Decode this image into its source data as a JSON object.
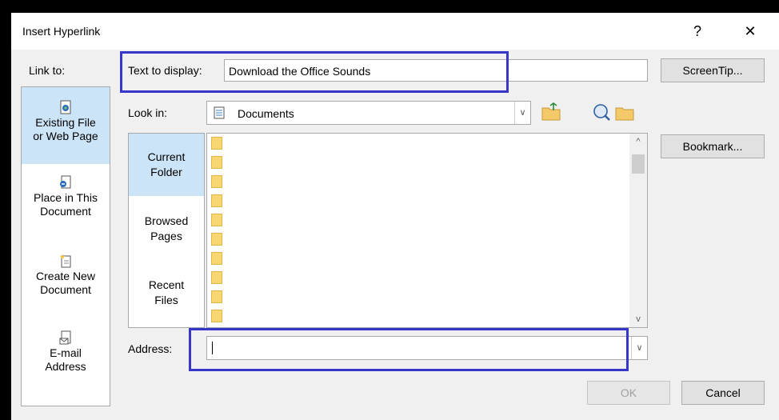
{
  "window": {
    "title": "Insert Hyperlink",
    "help_glyph": "?",
    "close_glyph": "✕"
  },
  "link_to": {
    "label": "Link to:",
    "items": [
      {
        "line1": "Existing File",
        "line2": "or Web Page",
        "icon": "existing-file-icon"
      },
      {
        "line1": "Place in This",
        "line2": "Document",
        "icon": "place-in-document-icon"
      },
      {
        "line1": "Create New",
        "line2": "Document",
        "icon": "create-new-document-icon"
      },
      {
        "line1": "E-mail",
        "line2": "Address",
        "icon": "email-address-icon"
      }
    ]
  },
  "text_to_display": {
    "label": "Text to display:",
    "value": "Download the Office Sounds"
  },
  "screentip_label": "ScreenTip...",
  "look_in": {
    "label": "Look in:",
    "value": "Documents"
  },
  "bookmark_label": "Bookmark...",
  "nav": {
    "items": [
      {
        "line1": "Current",
        "line2": "Folder"
      },
      {
        "line1": "Browsed",
        "line2": "Pages"
      },
      {
        "line1": "Recent",
        "line2": "Files"
      }
    ]
  },
  "scroll": {
    "up_glyph": "^",
    "down_glyph": "v"
  },
  "address": {
    "label": "Address:",
    "value": ""
  },
  "ok_label": "OK",
  "cancel_label": "Cancel",
  "colors": {
    "highlight_box": "#3636c8",
    "selected_bg": "#cce4f7",
    "folder": "#f7d774"
  }
}
